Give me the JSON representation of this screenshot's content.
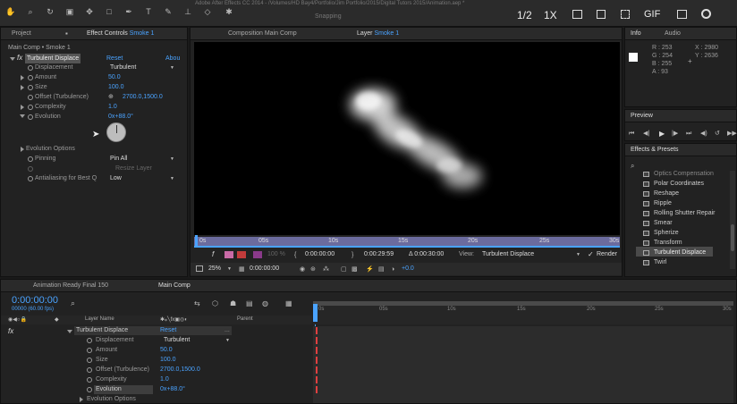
{
  "menubar": {
    "title": "Adobe After Effects CC 2014 - /Volumes/HD Bay4/Portfolio/Jim Portfolio/2015/Digital Tutors 2015/Animation.aep *",
    "snapping": "Snapping",
    "fraction": "1/2",
    "zoom_factor": "1X",
    "gif_label": "GIF"
  },
  "effect_controls": {
    "tab_project": "Project",
    "tab_effect_controls": "Effect Controls",
    "tab_layer_name": "Smoke 1",
    "breadcrumb": "Main Comp • Smoke 1",
    "effect_name": "Turbulent Displace",
    "reset": "Reset",
    "about": "Abou",
    "props": {
      "displacement_label": "Displacement",
      "displacement_value": "Turbulent",
      "amount_label": "Amount",
      "amount_value": "50.0",
      "size_label": "Size",
      "size_value": "100.0",
      "offset_label": "Offset (Turbulence)",
      "offset_value": "2700.0,1500.0",
      "complexity_label": "Complexity",
      "complexity_value": "1.0",
      "evolution_label": "Evolution",
      "evolution_value": "0x+88.0°",
      "evolution_options_label": "Evolution Options",
      "pinning_label": "Pinning",
      "pinning_value": "Pin All",
      "resize_layer_label": "Resize Layer",
      "antialiasing_label": "Antialiasing for Best Q",
      "antialiasing_value": "Low"
    }
  },
  "viewer": {
    "tab_composition": "Composition Main Comp",
    "tab_layer": "Layer",
    "tab_layer_name": "Smoke 1",
    "ruler_ticks": [
      "0s",
      "05s",
      "10s",
      "15s",
      "20s",
      "25s",
      "30s"
    ],
    "zoom_percent": "100 %",
    "time_in": "0:00:00:00",
    "time_out": "0:00:29:59",
    "duration": "Δ 0:00:30:00",
    "view_label": "View:",
    "view_value": "Turbulent Displace",
    "render_label": "Render",
    "magnification": "25%",
    "current_time": "0:00:00:00",
    "exposure": "+0.0"
  },
  "info": {
    "tab_info": "Info",
    "tab_audio": "Audio",
    "r": "R : 253",
    "g": "G : 254",
    "b": "B : 255",
    "a": "A : 93",
    "x": "X : 2980",
    "y": "Y : 2636"
  },
  "preview": {
    "tab": "Preview"
  },
  "effects_presets": {
    "tab": "Effects & Presets",
    "items": [
      "Optics Compensation",
      "Polar Coordinates",
      "Reshape",
      "Ripple",
      "Rolling Shutter Repair",
      "Smear",
      "Spherize",
      "Transform",
      "Turbulent Displace",
      "Twirl"
    ],
    "selected_index": 8
  },
  "timeline": {
    "tab_animation": "Animation Ready Final 150",
    "tab_main": "Main Comp",
    "timecode": "0:00:00:00",
    "fps": "00000 (60.00 fps)",
    "col_layer_name": "Layer Name",
    "col_parent": "Parent",
    "ruler_ticks": [
      "0s",
      "05s",
      "10s",
      "15s",
      "20s",
      "25s",
      "30s"
    ],
    "effect_name": "Turbulent Displace",
    "reset": "Reset",
    "more": "...",
    "props": {
      "displacement_label": "Displacement",
      "displacement_value": "Turbulent",
      "amount_label": "Amount",
      "amount_value": "50.0",
      "size_label": "Size",
      "size_value": "100.0",
      "offset_label": "Offset (Turbulence)",
      "offset_value": "2700.0,1500.0",
      "complexity_label": "Complexity",
      "complexity_value": "1.0",
      "evolution_label": "Evolution",
      "evolution_value": "0x+88.0°",
      "evolution_options_label": "Evolution Options"
    }
  },
  "colors": {
    "accent": "#4aa3ff",
    "playhead": "#4aa3ff",
    "keyframe": "#e04040",
    "selected_bg": "#3b3b3b",
    "panel_bg": "#222222",
    "viewer_bg": "#000000"
  }
}
